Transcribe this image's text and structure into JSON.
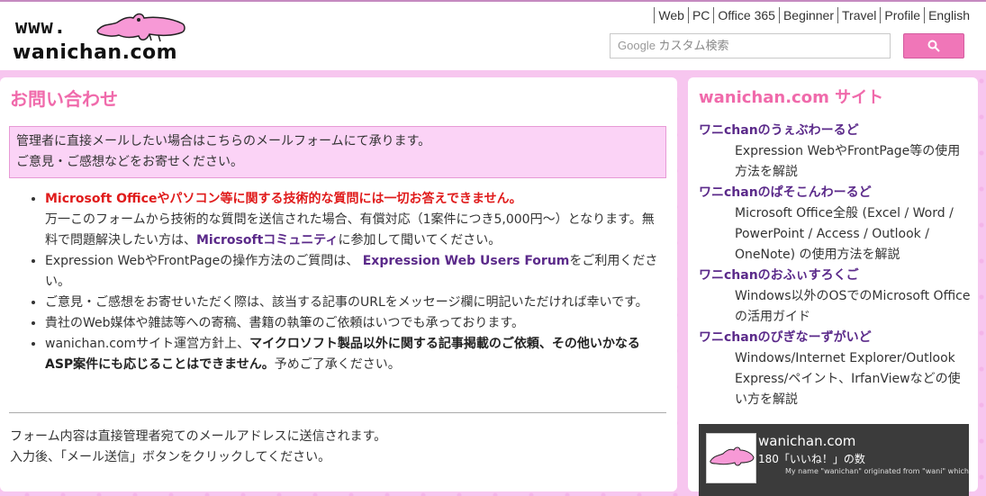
{
  "header": {
    "logo_line1": "www.",
    "logo_line2": "wanichan.com",
    "nav": [
      "Web",
      "PC",
      "Office 365",
      "Beginner",
      "Travel",
      "Profile",
      "English"
    ],
    "search_brand": "Google",
    "search_placeholder": "カスタム検索"
  },
  "main": {
    "title": "お問い合わせ",
    "notice_line1": "管理者に直接メールしたい場合はこちらのメールフォームにて承ります。",
    "notice_line2": "ご意見・ご感想などをお寄せください。",
    "b1_red": "Microsoft Officeやパソコン等に関する技術的な質問には一切お答えできません。",
    "b1_text_a": "万一このフォームから技術的な質問を送信された場合、有償対応（1案件につき5,000円～）となります。無料で問題解決したい方は、",
    "b1_link": "Microsoftコミュニティ",
    "b1_text_b": "に参加して聞いてください。",
    "b2_text_a": "Expression WebやFrontPageの操作方法のご質問は、",
    "b2_link": "Expression Web Users Forum",
    "b2_text_b": "をご利用ください。",
    "b3_text": "ご意見・ご感想をお寄せいただく際は、該当する記事のURLをメッセージ欄に明記いただければ幸いです。",
    "b4_text": "貴社のWeb媒体や雑誌等への寄稿、書籍の執筆のご依頼はいつでも承っております。",
    "b5_text_a": "wanichan.comサイト運営方針上、",
    "b5_bold": "マイクロソフト製品以外に関する記事掲載のご依頼、その他いかなるASP案件にも応じることはできません。",
    "b5_text_b": "予めご了承ください。",
    "form_note_line1": "フォーム内容は直接管理者宛てのメールアドレスに送信されます。",
    "form_note_line2": "入力後、「メール送信」ボタンをクリックしてください。"
  },
  "sidebar": {
    "title": "wanichan.com サイト",
    "sites": [
      {
        "name": "ワニchanのうぇぶわーるど",
        "desc": "Expression WebやFrontPage等の使用方法を解説"
      },
      {
        "name": "ワニchanのぱそこんわーるど",
        "desc": "Microsoft Office全般 (Excel / Word / PowerPoint / Access / Outlook / OneNote) の使用方法を解説"
      },
      {
        "name": "ワニchanのおふぃすろくご",
        "desc": "Windows以外のOSでのMicrosoft Officeの活用ガイド"
      },
      {
        "name": "ワニchanのびぎなーずがいど",
        "desc": "Windows/Internet Explorer/Outlook Express/ペイント、IrfanViewなどの使い方を解説"
      }
    ],
    "fb_name": "wanichan.com",
    "fb_likes": "180「いいね！」の数",
    "fb_text": "My name \"wanichan\" originated from \"wani\" which means crocodile"
  },
  "colors": {
    "accent": "#f06aab",
    "link": "#5b2a8a",
    "notice_bg": "#fbd3f6",
    "background": "#f7c6ef",
    "search_button": "#f076b8"
  }
}
